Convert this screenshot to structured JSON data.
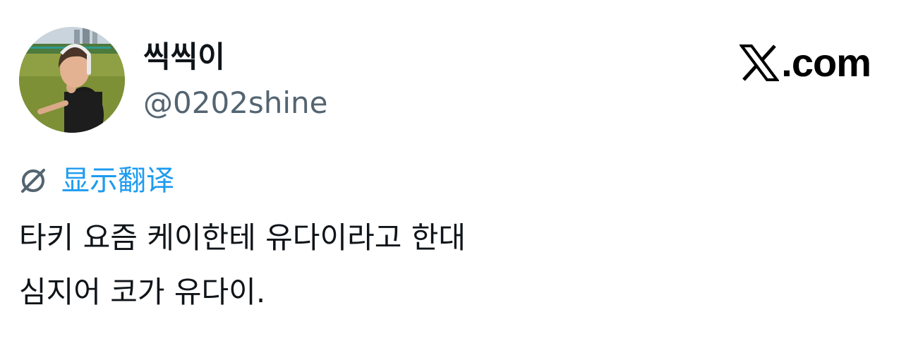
{
  "author": {
    "display_name": "씩씩이",
    "handle": "@0202shine",
    "avatar": "profile-photo"
  },
  "brand": {
    "logo_icon": "x-logo-icon",
    "domain_text": ".com"
  },
  "translate": {
    "icon": "globe-icon",
    "label": "显示翻译",
    "color": "#1d9bf0"
  },
  "tweet": {
    "lines": [
      "타키 요즘 케이한테 유다이라고 한대",
      "심지어 코가 유다이."
    ]
  },
  "colors": {
    "text": "#0f1419",
    "secondary_text": "#536471",
    "link": "#1d9bf0",
    "background": "#ffffff"
  }
}
